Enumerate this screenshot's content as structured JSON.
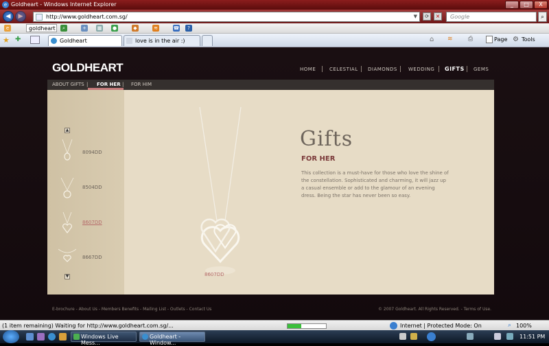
{
  "window": {
    "title": "Goldheart - Windows Internet Explorer",
    "min": "_",
    "max": "□",
    "close": "X"
  },
  "address": {
    "url": "http://www.goldheart.com.sg/",
    "search_placeholder": "Google"
  },
  "toolbar": {
    "search_value": "goldheart"
  },
  "tabs": [
    {
      "label": "Goldheart"
    },
    {
      "label": "love is in the air :)"
    }
  ],
  "commands": {
    "page": "Page",
    "tools": "Tools"
  },
  "site": {
    "logo": "GOLDHEART",
    "nav": [
      "HOME",
      "CELESTIAL",
      "DIAMONDS",
      "WEDDING",
      "GIFTS",
      "GEMS"
    ],
    "subnav": [
      "ABOUT GIFTS",
      "|",
      "FOR HER",
      "|",
      "FOR HIM"
    ],
    "products": [
      {
        "code": "8094DD"
      },
      {
        "code": "8504DD"
      },
      {
        "code": "8607DD"
      },
      {
        "code": "8667DD"
      }
    ],
    "heading": "Gifts",
    "subheading": "FOR HER",
    "description": "This collection is a must-have for those who love the shine of the constellation. Sophisticated and charming, it will jazz up a casual ensemble or add to the glamour of an evening dress. Being the star has never been so easy.",
    "selected_code": "8607DD",
    "footer_links": "E-brochure - About Us - Members Benefits - Mailing List - Outlets - Contact Us",
    "footer_copyright": "© 2007 Goldheart. All Rights Reserved. - Terms of Use."
  },
  "status": {
    "text": "(1 item remaining) Waiting for http://www.goldheart.com.sg/...",
    "zone": "Internet | Protected Mode: On",
    "zoom": "100%",
    "progress": 0.35
  },
  "taskbar": {
    "tasks": [
      {
        "label": "Windows Live Mess..."
      },
      {
        "label": "Goldheart - Window..."
      }
    ],
    "clock": "11:51 PM"
  }
}
